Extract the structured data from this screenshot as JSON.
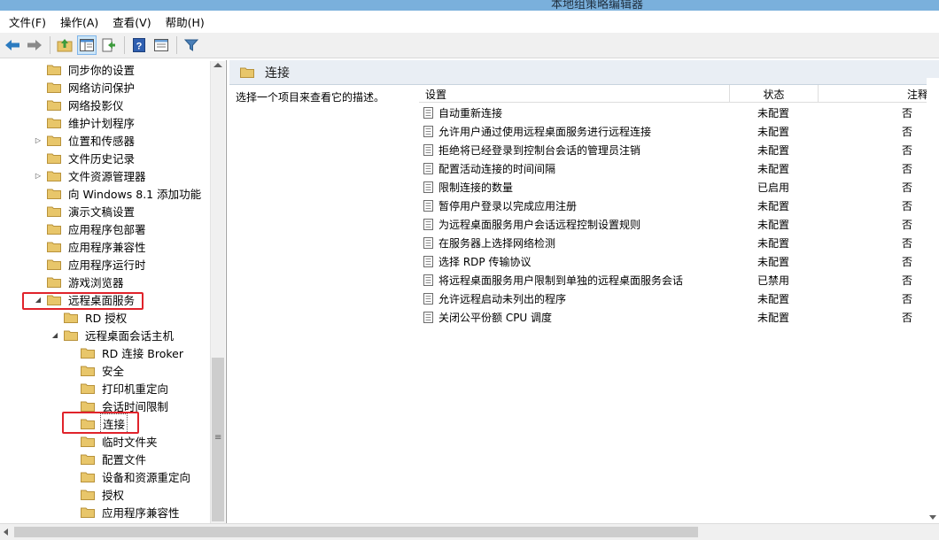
{
  "window": {
    "title": "本地组策略编辑器"
  },
  "menu": [
    {
      "label": "文件(F)"
    },
    {
      "label": "操作(A)"
    },
    {
      "label": "查看(V)"
    },
    {
      "label": "帮助(H)"
    }
  ],
  "toolbar": {
    "buttons": [
      "back-icon",
      "forward-icon",
      "up-folder-icon",
      "show-hide-tree-icon",
      "export-list-icon",
      "help-icon",
      "properties-icon",
      "filter-icon"
    ]
  },
  "tree": {
    "items": [
      {
        "label": "同步你的设置",
        "expander": ""
      },
      {
        "label": "网络访问保护",
        "expander": ""
      },
      {
        "label": "网络投影仪",
        "expander": ""
      },
      {
        "label": "维护计划程序",
        "expander": ""
      },
      {
        "label": "位置和传感器",
        "expander": "▷"
      },
      {
        "label": "文件历史记录",
        "expander": ""
      },
      {
        "label": "文件资源管理器",
        "expander": "▷"
      },
      {
        "label": "向 Windows 8.1 添加功能",
        "expander": ""
      },
      {
        "label": "演示文稿设置",
        "expander": ""
      },
      {
        "label": "应用程序包部署",
        "expander": ""
      },
      {
        "label": "应用程序兼容性",
        "expander": ""
      },
      {
        "label": "应用程序运行时",
        "expander": ""
      },
      {
        "label": "游戏浏览器",
        "expander": ""
      },
      {
        "label": "远程桌面服务",
        "expander": "◢"
      },
      {
        "label": "RD 授权",
        "expander": ""
      },
      {
        "label": "远程桌面会话主机",
        "expander": "◢"
      },
      {
        "label": "RD 连接 Broker",
        "expander": ""
      },
      {
        "label": "安全",
        "expander": ""
      },
      {
        "label": "打印机重定向",
        "expander": ""
      },
      {
        "label": "会话时间限制",
        "expander": ""
      },
      {
        "label": "连接",
        "expander": ""
      },
      {
        "label": "临时文件夹",
        "expander": ""
      },
      {
        "label": "配置文件",
        "expander": ""
      },
      {
        "label": "设备和资源重定向",
        "expander": ""
      },
      {
        "label": "授权",
        "expander": ""
      },
      {
        "label": "应用程序兼容性",
        "expander": ""
      }
    ]
  },
  "main": {
    "header_title": "连接",
    "description": "选择一个项目来查看它的描述。",
    "columns": {
      "setting": "设置",
      "state": "状态",
      "note": "注释"
    },
    "rows": [
      {
        "name": "自动重新连接",
        "state": "未配置",
        "note": "否"
      },
      {
        "name": "允许用户通过使用远程桌面服务进行远程连接",
        "state": "未配置",
        "note": "否"
      },
      {
        "name": "拒绝将已经登录到控制台会话的管理员注销",
        "state": "未配置",
        "note": "否"
      },
      {
        "name": "配置活动连接的时间间隔",
        "state": "未配置",
        "note": "否"
      },
      {
        "name": "限制连接的数量",
        "state": "已启用",
        "note": "否"
      },
      {
        "name": "暂停用户登录以完成应用注册",
        "state": "未配置",
        "note": "否"
      },
      {
        "name": "为远程桌面服务用户会话远程控制设置规则",
        "state": "未配置",
        "note": "否"
      },
      {
        "name": "在服务器上选择网络检测",
        "state": "未配置",
        "note": "否"
      },
      {
        "name": "选择 RDP 传输协议",
        "state": "未配置",
        "note": "否"
      },
      {
        "name": "将远程桌面服务用户限制到单独的远程桌面服务会话",
        "state": "已禁用",
        "note": "否"
      },
      {
        "name": "允许远程启动未列出的程序",
        "state": "未配置",
        "note": "否"
      },
      {
        "name": "关闭公平份额 CPU 调度",
        "state": "未配置",
        "note": "否"
      }
    ]
  },
  "scrollbar": {
    "grip": "≡"
  },
  "colors": {
    "highlight": "#e0232b",
    "folder": "#e8c66a",
    "titlebar": "#7ab0dc"
  }
}
